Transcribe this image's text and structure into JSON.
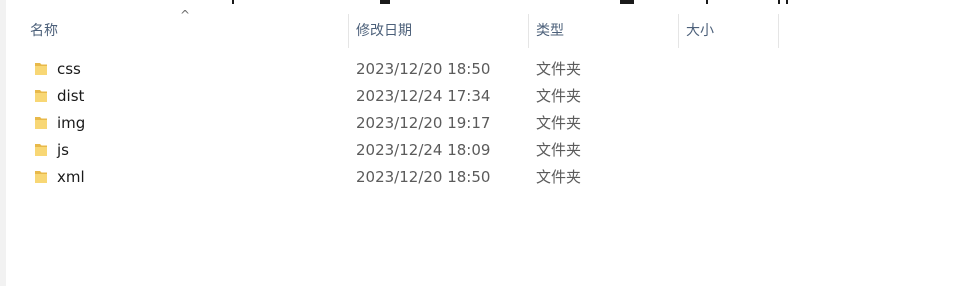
{
  "columns": {
    "name": "名称",
    "modified": "修改日期",
    "type": "类型",
    "size": "大小"
  },
  "sort_indicator": "^",
  "files": [
    {
      "name": "css",
      "modified": "2023/12/20 18:50",
      "type": "文件夹",
      "size": "",
      "icon": "folder-icon"
    },
    {
      "name": "dist",
      "modified": "2023/12/24 17:34",
      "type": "文件夹",
      "size": "",
      "icon": "folder-icon"
    },
    {
      "name": "img",
      "modified": "2023/12/20 19:17",
      "type": "文件夹",
      "size": "",
      "icon": "folder-icon"
    },
    {
      "name": "js",
      "modified": "2023/12/24 18:09",
      "type": "文件夹",
      "size": "",
      "icon": "folder-icon"
    },
    {
      "name": "xml",
      "modified": "2023/12/20 18:50",
      "type": "文件夹",
      "size": "",
      "icon": "folder-icon"
    }
  ],
  "colors": {
    "header_text": "#4c607a",
    "folder_yellow": "#f8d775",
    "folder_dark": "#e8b94a"
  }
}
